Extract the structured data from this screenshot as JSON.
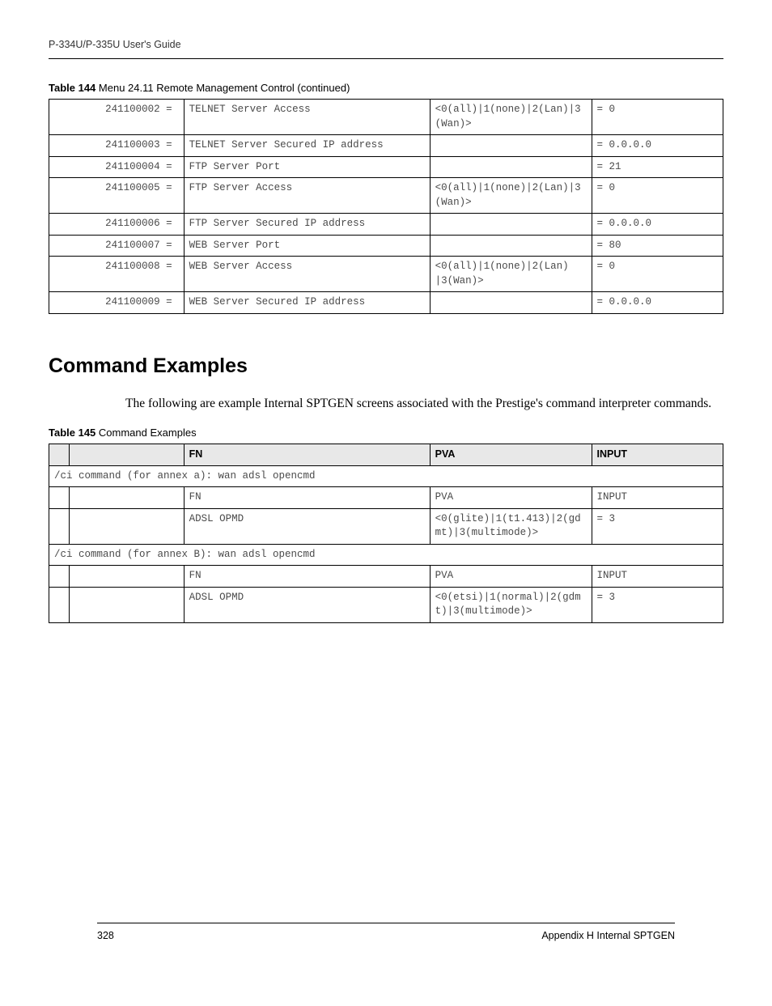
{
  "header": "P-334U/P-335U User's Guide",
  "table144_caption_bold": "Table 144",
  "table144_caption_rest": "   Menu 24.11 Remote Management Control  (continued)",
  "table144": [
    {
      "id": "241100002 =",
      "desc": "TELNET Server Access",
      "pva": "<0(all)|1(none)|2(Lan)|3(Wan)>",
      "input": "= 0"
    },
    {
      "id": "241100003 =",
      "desc": "TELNET Server Secured IP address",
      "pva": "",
      "input": "= 0.0.0.0"
    },
    {
      "id": "241100004 =",
      "desc": "FTP Server Port",
      "pva": "",
      "input": "= 21"
    },
    {
      "id": "241100005 =",
      "desc": "FTP Server Access",
      "pva": "<0(all)|1(none)|2(Lan)|3(Wan)>",
      "input": "= 0"
    },
    {
      "id": "241100006 =",
      "desc": "FTP Server Secured IP address",
      "pva": "",
      "input": "= 0.0.0.0"
    },
    {
      "id": "241100007 =",
      "desc": "WEB Server Port",
      "pva": "",
      "input": "= 80"
    },
    {
      "id": "241100008 =",
      "desc": "WEB Server Access",
      "pva": "<0(all)|1(none)|2(Lan) |3(Wan)>",
      "input": "= 0"
    },
    {
      "id": "241100009 =",
      "desc": "WEB Server Secured IP address",
      "pva": "",
      "input": "= 0.0.0.0"
    }
  ],
  "section_heading": "Command Examples",
  "body_text": "The following are example Internal SPTGEN screens associated with the Prestige's command interpreter commands.",
  "table145_caption_bold": "Table 145",
  "table145_caption_rest": "   Command Examples",
  "t145_headers": {
    "fn": "FN",
    "pva": "PVA",
    "input": "INPUT"
  },
  "t145": {
    "span1": "/ci command (for annex a): wan adsl opencmd",
    "r1": {
      "fn": "FN",
      "pva": "PVA",
      "input": "INPUT"
    },
    "r2": {
      "fn": "ADSL OPMD",
      "pva": "<0(glite)|1(t1.413)|2(gdmt)|3(multimode)>",
      "input": "= 3"
    },
    "span2": "/ci command (for annex B): wan adsl opencmd",
    "r3": {
      "fn": "FN",
      "pva": "PVA",
      "input": "INPUT"
    },
    "r4": {
      "fn": "ADSL OPMD",
      "pva": "<0(etsi)|1(normal)|2(gdmt)|3(multimode)>",
      "input": "= 3"
    }
  },
  "footer_page": "328",
  "footer_label": "Appendix H Internal SPTGEN"
}
